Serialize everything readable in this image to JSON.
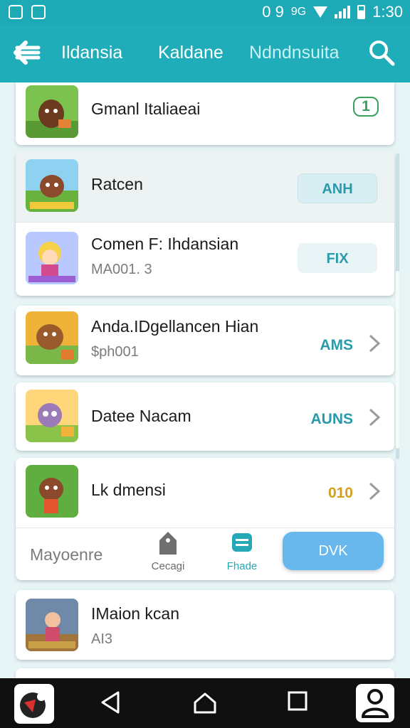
{
  "status_bar": {
    "left_icons": [
      "square-a-icon",
      "square-a-icon"
    ],
    "indicators": "0 9",
    "extra": "9G",
    "time": "1:30"
  },
  "app_bar": {
    "back_icon": "back-arrow-icon",
    "tabs": [
      "Ildansia",
      "Kaldane",
      "Ndndnsuita"
    ],
    "search_icon": "search-icon"
  },
  "list": [
    {
      "title": "Gmanl Italiaeai",
      "badge": "1",
      "badge_color": "#3aa15d"
    },
    {
      "title": "Ratcen",
      "button": "ANH"
    },
    {
      "title": "Comen F: Ihdansian",
      "subtitle": "MA001.    3",
      "button": "FIX"
    },
    {
      "title": "Anda.IDgellancen Hian",
      "subtitle": "$ph001",
      "badge": "AMS",
      "badge_color": "#2a9aab"
    },
    {
      "title": "Datee Nacam",
      "badge": "AUNS",
      "badge_color": "#2a9aab"
    },
    {
      "title": "Lk dmensi",
      "badge": "010",
      "badge_color": "#d4a020"
    },
    {
      "title": "Mayoenre"
    },
    {
      "title": "IMaion kcan",
      "subtitle": "AI3"
    }
  ],
  "floating": {
    "nav1": "Cecagi",
    "nav2": "Fhade",
    "download_button": "DVK"
  },
  "system_nav": {
    "back_icon": "back-triangle-icon",
    "home_icon": "home-icon",
    "recents_icon": "recents-square-icon",
    "user_icon": "user-icon"
  }
}
